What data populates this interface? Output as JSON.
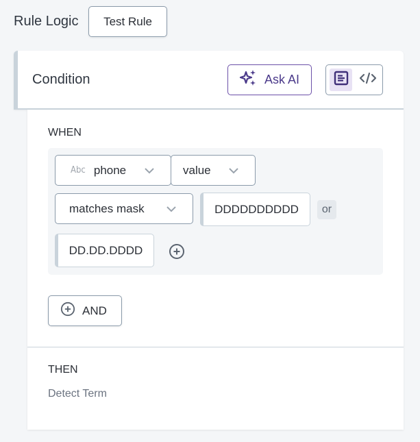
{
  "header": {
    "title": "Rule Logic",
    "test_button": "Test Rule"
  },
  "condition": {
    "title": "Condition",
    "ask_ai_button": "Ask AI",
    "view_toggle": {
      "options": [
        "visual-editor",
        "code-editor"
      ],
      "active": "visual-editor"
    }
  },
  "when": {
    "label": "WHEN",
    "field": {
      "type_badge": "Abc",
      "value": "phone"
    },
    "property": {
      "value": "value"
    },
    "operator": {
      "value": "matches mask"
    },
    "masks": [
      "DDDDDDDDDD",
      "DD.DD.DDDD"
    ],
    "or_label": "or",
    "and_button": "AND"
  },
  "then": {
    "label": "THEN",
    "action": "Detect Term"
  },
  "colors": {
    "accent": "#6b4fa8",
    "accent_bg": "#e8e2f4",
    "border": "#8a9aaa",
    "page_bg": "#f4f6f8"
  }
}
